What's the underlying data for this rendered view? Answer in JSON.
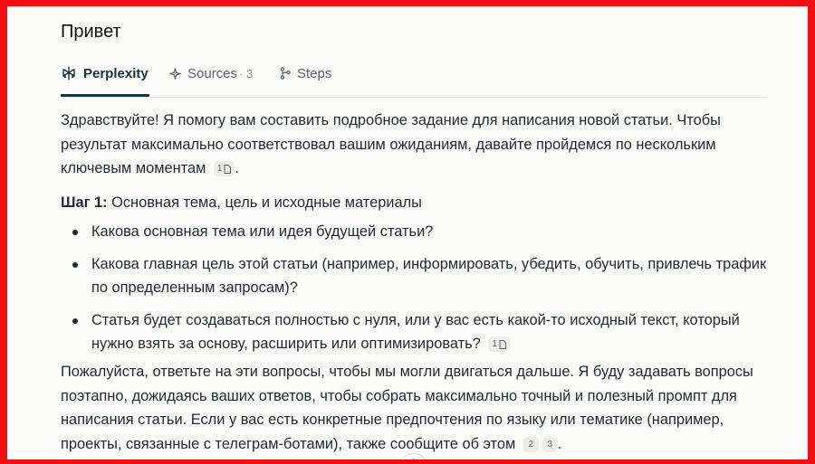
{
  "page": {
    "title": "Привет"
  },
  "tabs": [
    {
      "label": "Perplexity",
      "icon": "perplexity-logo-icon",
      "active": true
    },
    {
      "label": "Sources",
      "count": "· 3",
      "icon": "sources-icon"
    },
    {
      "label": "Steps",
      "icon": "steps-icon"
    }
  ],
  "answer": {
    "intro": "Здравствуйте! Я помогу вам составить подробное задание для написания новой статьи. Чтобы результат максимально соответствовал вашим ожиданиям, давайте пройдемся по нескольким ключевым моментам",
    "intro_cite": "1",
    "step_prefix": "Шаг 1:",
    "step_text": " Основная тема, цель и исходные материалы",
    "bullets": [
      {
        "text": "Какова основная тема или идея будущей статьи?"
      },
      {
        "text": "Какова главная цель этой статьи (например, информировать, убедить, обучить, привлечь трафик по определенным запросам)?"
      },
      {
        "text": "Статья будет создаваться полностью с нуля, или у вас есть какой-то исходный текст, который нужно взять за основу, расширить или оптимизировать?",
        "cite": "1"
      }
    ],
    "outro": "Пожалуйста, ответьте на эти вопросы, чтобы мы могли двигаться дальше. Я буду задавать вопросы поэтапно, дожидаясь ваших ответов, чтобы собрать максимально точный и полезный промпт для написания статьи. Если у вас есть конкретные предпочтения по языку или тематике (например, проекты, связанные с телеграм-ботами), также сообщите об этом",
    "outro_cites": [
      "2",
      "3"
    ],
    "outro_end": "."
  },
  "colors": {
    "frame": "#f20d12",
    "background": "#fbfbf9",
    "accent": "#13343b"
  }
}
